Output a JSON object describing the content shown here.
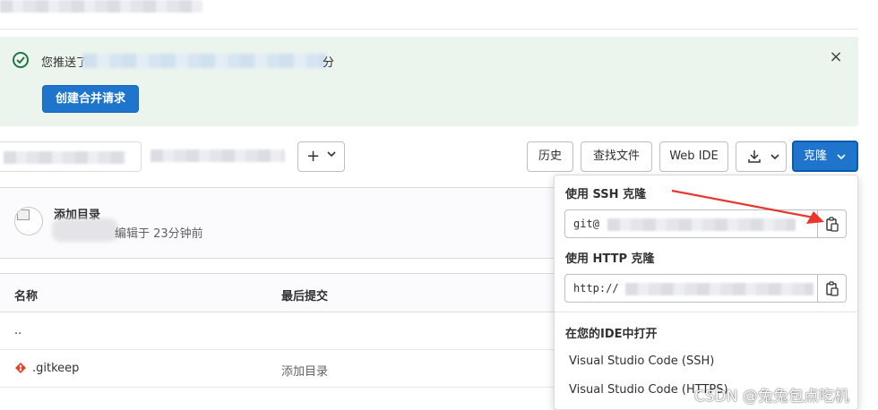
{
  "alert": {
    "message_prefix": "您推送了",
    "message_suffix": "分",
    "close_glyph": "×",
    "create_mr_label": "创建合并请求"
  },
  "toolbar": {
    "plus_glyph": "+",
    "history_label": "历史",
    "find_file_label": "查找文件",
    "web_ide_label": "Web IDE",
    "clone_label": "克隆"
  },
  "commit": {
    "title": "添加目录",
    "meta": "编辑于 23分钟前"
  },
  "table": {
    "headers": {
      "name": "名称",
      "last_commit": "最后提交"
    },
    "rows": [
      {
        "name": "..",
        "commit": ""
      },
      {
        "name": ".gitkeep",
        "commit": "添加目录"
      }
    ]
  },
  "clone_dropdown": {
    "ssh_label": "使用 SSH 克隆",
    "ssh_url_prefix": "git@",
    "http_label": "使用 HTTP 克隆",
    "http_url_prefix": "http://",
    "ide_section_label": "在您的IDE中打开",
    "ide_items": [
      "Visual Studio Code (SSH)",
      "Visual Studio Code (HTTPS)"
    ]
  },
  "watermark": "CSDN @兔兔包点吃机",
  "icons": {
    "success": "check-circle-icon",
    "close": "close-icon",
    "plus": "plus-icon",
    "chevron": "chevron-down-icon",
    "download": "download-icon",
    "copy": "copy-to-clipboard-icon",
    "git_file": "git-file-icon",
    "avatar": "broken-image-icon"
  },
  "colors": {
    "primary_button": "#1f75cb",
    "alert_background": "#ecf4ee",
    "success_icon": "#217645",
    "annotation_arrow": "#e8352e"
  }
}
